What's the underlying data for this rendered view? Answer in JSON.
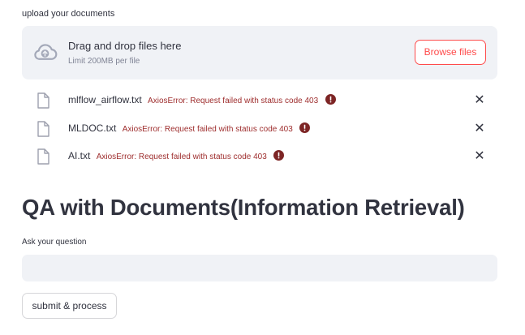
{
  "uploader": {
    "label": "upload your documents",
    "dropzone_title": "Drag and drop files here",
    "dropzone_limit": "Limit 200MB per file",
    "browse_label": "Browse files",
    "icon": "cloud-upload-icon"
  },
  "files": [
    {
      "name": "mlflow_airflow.txt",
      "error": "AxiosError: Request failed with status code 403",
      "icon": "file-icon",
      "status_icon": "error-icon",
      "remove_icon": "close-icon"
    },
    {
      "name": "MLDOC.txt",
      "error": "AxiosError: Request failed with status code 403",
      "icon": "file-icon",
      "status_icon": "error-icon",
      "remove_icon": "close-icon"
    },
    {
      "name": "AI.txt",
      "error": "AxiosError: Request failed with status code 403",
      "icon": "file-icon",
      "status_icon": "error-icon",
      "remove_icon": "close-icon"
    }
  ],
  "main": {
    "title": "QA with Documents(Information Retrieval)",
    "question_label": "Ask your question",
    "question_value": "",
    "submit_label": "submit & process"
  },
  "colors": {
    "accent": "#ff4b4b",
    "error": "#9e2d2d",
    "panel_bg": "#f0f2f6",
    "text": "#31333f",
    "muted": "#808495"
  }
}
